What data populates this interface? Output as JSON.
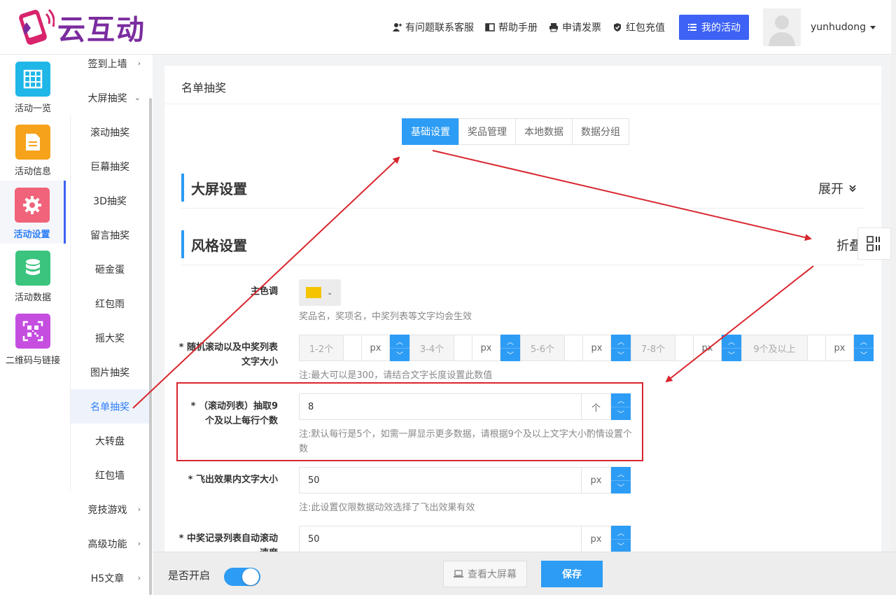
{
  "header": {
    "logo_text": "云互动",
    "links": [
      {
        "label": "有问题联系客服",
        "icon": "user-plus-icon"
      },
      {
        "label": "帮助手册",
        "icon": "book-icon"
      },
      {
        "label": "申请发票",
        "icon": "printer-icon"
      },
      {
        "label": "红包充值",
        "icon": "shield-check-icon"
      }
    ],
    "my_activity_label": "我的活动",
    "username": "yunhudong"
  },
  "rail": {
    "items": [
      {
        "label": "活动一览",
        "color": "#1fb6e8",
        "icon": "grid-icon"
      },
      {
        "label": "活动信息",
        "color": "#f7a21b",
        "icon": "document-icon"
      },
      {
        "label": "活动设置",
        "color": "#f0637a",
        "icon": "gear-icon",
        "active": true
      },
      {
        "label": "活动数据",
        "color": "#3ac47d",
        "icon": "database-icon"
      },
      {
        "label": "二维码与链接",
        "color": "#c54ee0",
        "icon": "qrcode-icon"
      }
    ]
  },
  "submenu": {
    "top": [
      {
        "label": "签到上墙",
        "chevron": "›"
      },
      {
        "label": "大屏抽奖",
        "chevron": "⌄"
      }
    ],
    "children": [
      "滚动抽奖",
      "巨幕抽奖",
      "3D抽奖",
      "留言抽奖",
      "砸金蛋",
      "红包雨",
      "摇大奖",
      "图片抽奖",
      "名单抽奖",
      "大转盘",
      "红包墙"
    ],
    "active_child": "名单抽奖",
    "bottom": [
      {
        "label": "竞技游戏",
        "chevron": "›"
      },
      {
        "label": "高级功能",
        "chevron": "›"
      },
      {
        "label": "H5文章",
        "chevron": "›"
      }
    ]
  },
  "main": {
    "title": "名单抽奖",
    "tabs": [
      "基础设置",
      "奖品管理",
      "本地数据",
      "数据分组"
    ],
    "active_tab": "基础设置",
    "section_screen": {
      "title": "大屏设置",
      "toggle": "展开"
    },
    "section_style": {
      "title": "风格设置",
      "toggle": "折叠"
    },
    "main_color": {
      "label": "主色调",
      "value": "#f5c400",
      "note": "奖品名，奖项名，中奖列表等文字均会生效"
    },
    "font_sizes": {
      "label": "* 随机滚动以及中奖列表文字大小",
      "groups": [
        {
          "range": "1-2个",
          "unit": "px"
        },
        {
          "range": "3-4个",
          "unit": "px"
        },
        {
          "range": "5-6个",
          "unit": "px"
        },
        {
          "range": "7-8个",
          "unit": "px"
        },
        {
          "range": "9个及以上",
          "unit": "px"
        }
      ],
      "note": "注:最大可以是300，请结合文字长度设置此数值"
    },
    "per_row": {
      "label": "* （滚动列表）抽取9个及以上每行个数",
      "value": "8",
      "unit": "个",
      "note": "注:默认每行是5个，如需一屏显示更多数据，请根据9个及以上文字大小酌情设置个数"
    },
    "fly_size": {
      "label": "* 飞出效果内文字大小",
      "value": "50",
      "unit": "px",
      "note": "注:此设置仅限数据动效选择了飞出效果有效"
    },
    "scroll_speed": {
      "label": "* 中奖记录列表自动滚动速度",
      "value": "50",
      "unit": "px"
    }
  },
  "footer": {
    "switch_label": "是否开启",
    "switch_on": true,
    "view_screen_label": "查看大屏幕",
    "save_label": "保存"
  }
}
